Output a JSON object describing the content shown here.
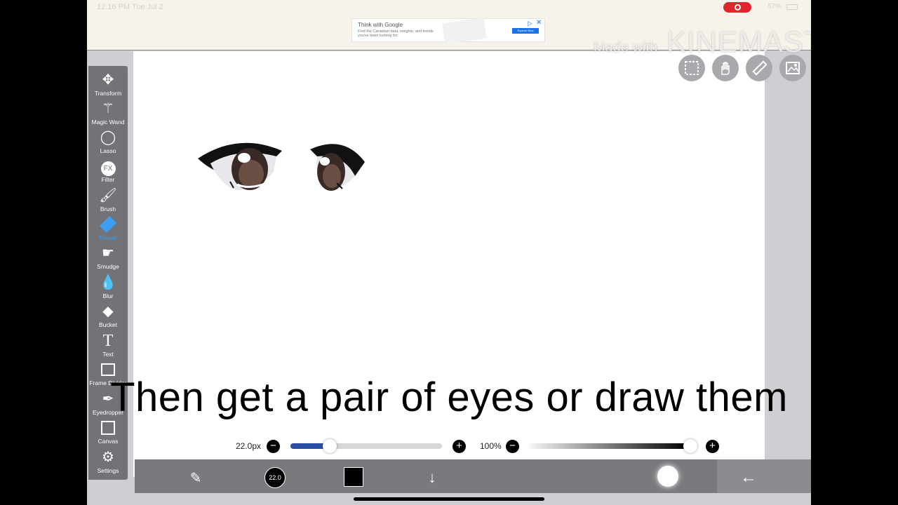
{
  "status": {
    "time": "12:16 PM   Tue Jul 2",
    "battery": "57%"
  },
  "ad": {
    "title": "Think with Google",
    "text": "Find the Canadian data, insights, and trends you've been looking for.",
    "cta": "Explore Now"
  },
  "watermark": {
    "prefix": "Made with",
    "brand": "KINEMASTER"
  },
  "tools": [
    {
      "label": "Transform",
      "icon": "move-arrows-icon"
    },
    {
      "label": "Magic Wand",
      "icon": "magic-wand-icon"
    },
    {
      "label": "Lasso",
      "icon": "lasso-icon"
    },
    {
      "label": "Filter",
      "icon": "fx-icon"
    },
    {
      "label": "Brush",
      "icon": "brush-icon"
    },
    {
      "label": "Eraser",
      "icon": "eraser-icon"
    },
    {
      "label": "Smudge",
      "icon": "smudge-icon"
    },
    {
      "label": "Blur",
      "icon": "drop-icon"
    },
    {
      "label": "Bucket",
      "icon": "bucket-icon"
    },
    {
      "label": "Text",
      "icon": "text-icon"
    },
    {
      "label": "Frame Divider",
      "icon": "frame-divider-icon"
    },
    {
      "label": "Eyedropper",
      "icon": "eyedropper-icon"
    },
    {
      "label": "Canvas",
      "icon": "canvas-icon"
    },
    {
      "label": "Settings",
      "icon": "gear-icon"
    }
  ],
  "active_tool": "Eraser",
  "colors": {
    "active_tool": "#3d9ff1",
    "slider_fill": "#2a4ea2",
    "record_badge": "#e0262c"
  },
  "caption": "Then get a pair of eyes or draw them",
  "brush": {
    "size_label": "22.0px",
    "size_fraction": 0.26,
    "opacity_label": "100%",
    "opacity_fraction": 1.0,
    "preview_label": "22.0"
  }
}
